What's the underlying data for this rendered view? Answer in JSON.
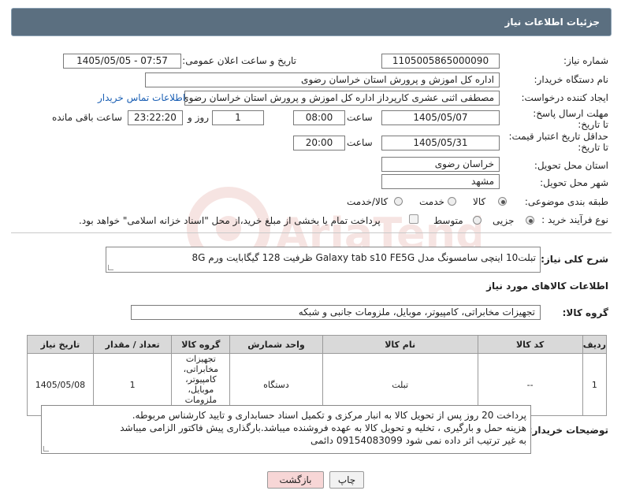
{
  "header": {
    "title": "جزئیات اطلاعات نیاز"
  },
  "form": {
    "need_number": {
      "label": "شماره نیاز:",
      "value": "1105005865000090"
    },
    "announce_datetime": {
      "label": "تاریخ و ساعت اعلان عمومی:",
      "value": "1405/05/05 - 07:57"
    },
    "buyer_org": {
      "label": "نام دستگاه خریدار:",
      "value": "اداره کل اموزش و پرورش استان خراسان رضوی"
    },
    "requester": {
      "label": "ایجاد کننده درخواست:",
      "value": "مصطفی اثنی عشری کارپرداز اداره کل اموزش و پرورش استان خراسان رضوی",
      "contact_link": "اطلاعات تماس خریدار"
    },
    "reply_deadline": {
      "label": "مهلت ارسال پاسخ: تا تاریخ:",
      "date": "1405/05/07",
      "time_label": "ساعت",
      "time": "08:00",
      "days": "1",
      "days_label": "روز و",
      "remaining": "23:22:20",
      "remaining_label": "ساعت باقی مانده"
    },
    "price_validity": {
      "label": "حداقل تاریخ اعتبار قیمت: تا تاریخ:",
      "date": "1405/05/31",
      "time_label": "ساعت",
      "time": "20:00"
    },
    "delivery_province": {
      "label": "استان محل تحویل:",
      "value": "خراسان رضوی"
    },
    "delivery_city": {
      "label": "شهر محل تحویل:",
      "value": "مشهد"
    },
    "category": {
      "label": "طبقه بندی موضوعی:",
      "options": [
        "کالا",
        "خدمت",
        "کالا/خدمت"
      ],
      "selected": 0
    },
    "purchase_type": {
      "label": "نوع فرآیند خرید :",
      "options": [
        "جزیی",
        "متوسط"
      ],
      "selected": 0,
      "note": "پرداخت تمام یا بخشی از مبلغ خرید،از محل \"اسناد خزانه اسلامی\" خواهد بود."
    }
  },
  "summary": {
    "label": "شرح کلی نیاز:",
    "value": "تبلت10 اینچی سامسونگ مدل Galaxy tab s10 FE5G ظرفیت 128 گیگابایت ورم 8G"
  },
  "goods_section": {
    "title": "اطلاعات کالاهای مورد نیاز"
  },
  "goods_group": {
    "label": "گروه کالا:",
    "value": "تجهیزات مخابراتی، کامپیوتر، موبایل، ملزومات جانبی و شبکه"
  },
  "table": {
    "headers": [
      "ردیف",
      "کد کالا",
      "نام کالا",
      "واحد شمارش",
      "گروه کالا",
      "تعداد / مقدار",
      "تاریخ نیاز"
    ],
    "rows": [
      [
        "1",
        "--",
        "تبلت",
        "دستگاه",
        "تجهیزات مخابراتی، کامپیوتر، موبایل، ملزومات جانبی و شبکه",
        "1",
        "1405/05/08"
      ]
    ]
  },
  "buyer_notes": {
    "label": "توضیحات خریدار:",
    "lines": [
      "پرداخت 20 روز پس از تحویل کالا به انبار مرکزی و تکمیل اسناد حسابداری و تایید کارشناس مربوطه.",
      "هزینه حمل و بارگیری ، تخلیه و تحویل کالا به عهده فروشنده میباشد.بارگذاری پیش فاکتور الزامی میباشد",
      "به غیر ترتیب اثر داده نمی شود 09154083099 دائمی"
    ]
  },
  "buttons": {
    "print": "چاپ",
    "back": "بازگشت"
  },
  "watermark": {
    "text": "AriaTender.neT"
  },
  "colors": {
    "title_bar": "#5b6f80",
    "link": "#1a5fb4",
    "back_button": "#f7d6d6"
  }
}
